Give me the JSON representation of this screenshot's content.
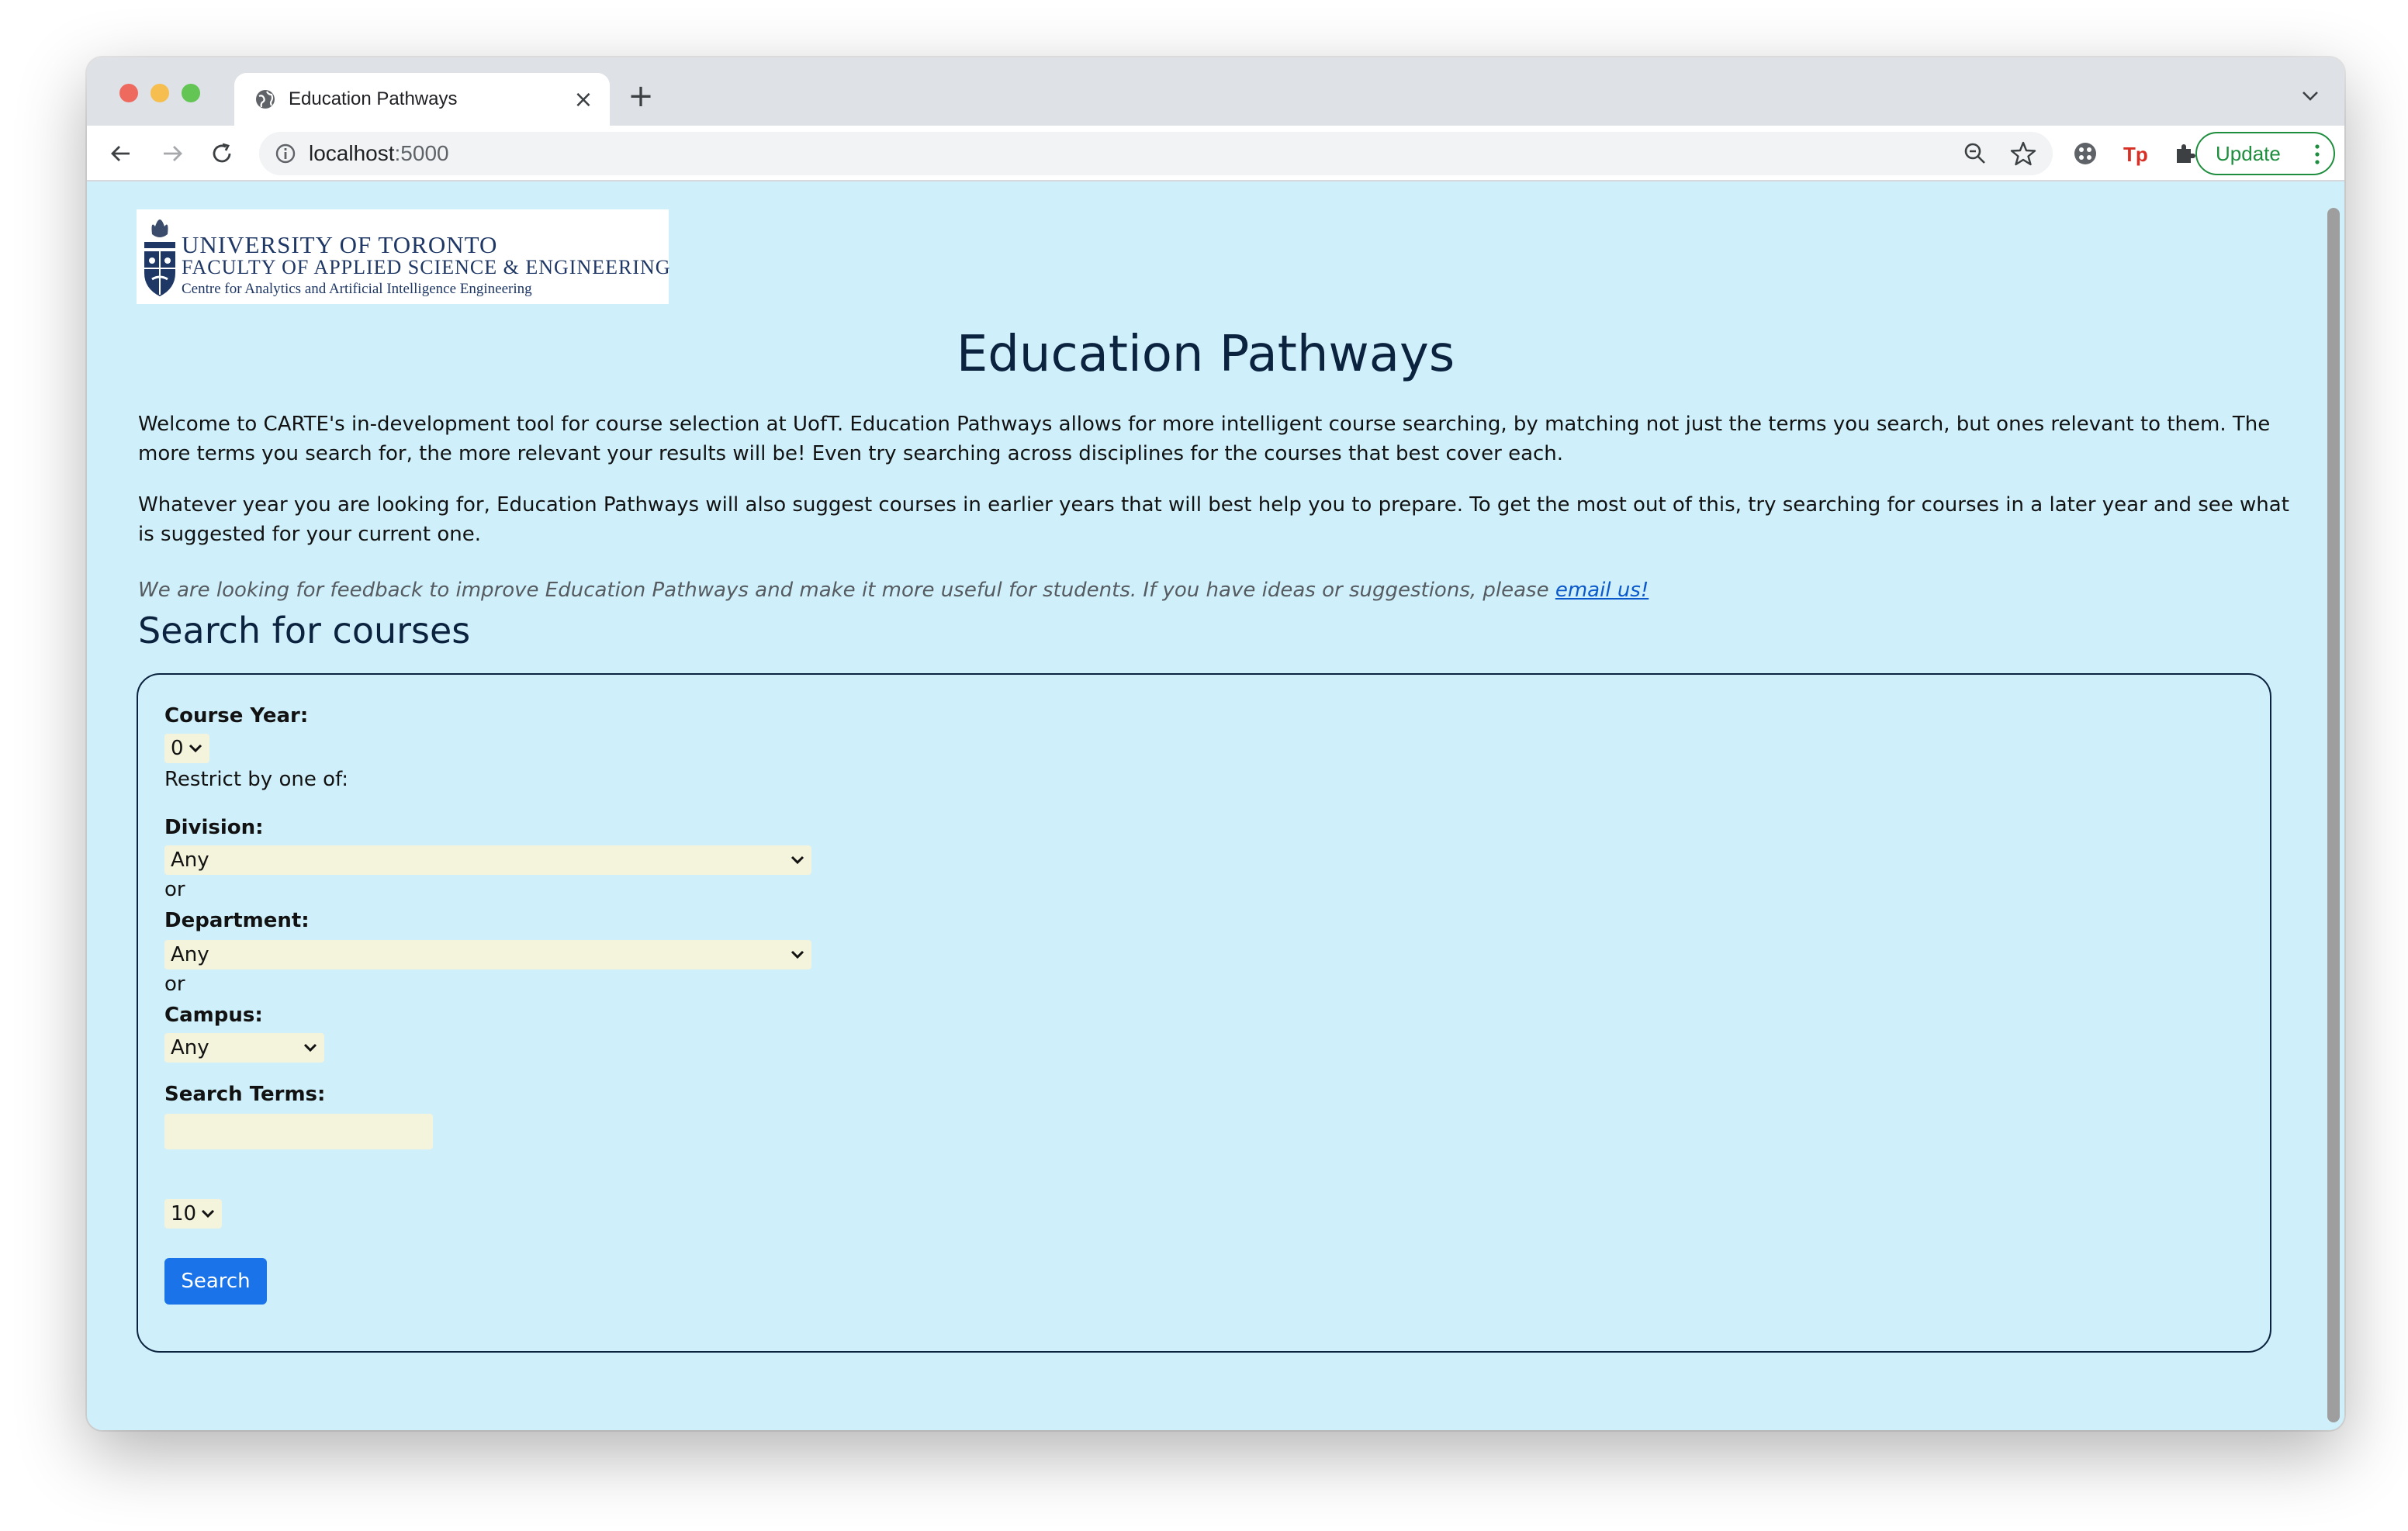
{
  "browser": {
    "tab_title": "Education Pathways",
    "url_host": "localhost",
    "url_port": ":5000",
    "update_label": "Update"
  },
  "logo": {
    "line1": "UNIVERSITY OF TORONTO",
    "line2": "FACULTY OF APPLIED SCIENCE & ENGINEERING",
    "line3": "Centre for Analytics and Artificial Intelligence Engineering"
  },
  "page": {
    "title": "Education Pathways",
    "intro_1": "Welcome to CARTE's in-development tool for course selection at UofT. Education Pathways allows for more intelligent course searching, by matching not just the terms you search, but ones relevant to them. The more terms you search for, the more relevant your results will be! Even try searching across disciplines for the courses that best cover each.",
    "intro_2": "Whatever year you are looking for, Education Pathways will also suggest courses in earlier years that will best help you to prepare. To get the most out of this, try searching for courses in a later year and see what is suggested for your current one.",
    "feedback_text": "We are looking for feedback to improve Education Pathways and make it more useful for students. If you have ideas or suggestions, please ",
    "feedback_link": "email us!"
  },
  "search": {
    "section_title": "Search for courses",
    "course_year_label": "Course Year:",
    "course_year_value": "0",
    "restrict_text": "Restrict by one of:",
    "division_label": "Division:",
    "division_value": "Any",
    "or_1": "or",
    "department_label": "Department:",
    "department_value": "Any",
    "or_2": "or",
    "campus_label": "Campus:",
    "campus_value": "Any",
    "terms_label": "Search Terms:",
    "terms_value": "",
    "results_count_value": "10",
    "search_button": "Search"
  },
  "colors": {
    "page_background": "#cff0fa",
    "heading": "#0c2340",
    "select_background": "#f4f3dc",
    "button": "#1a73e8",
    "update_green": "#1e8e3e"
  }
}
